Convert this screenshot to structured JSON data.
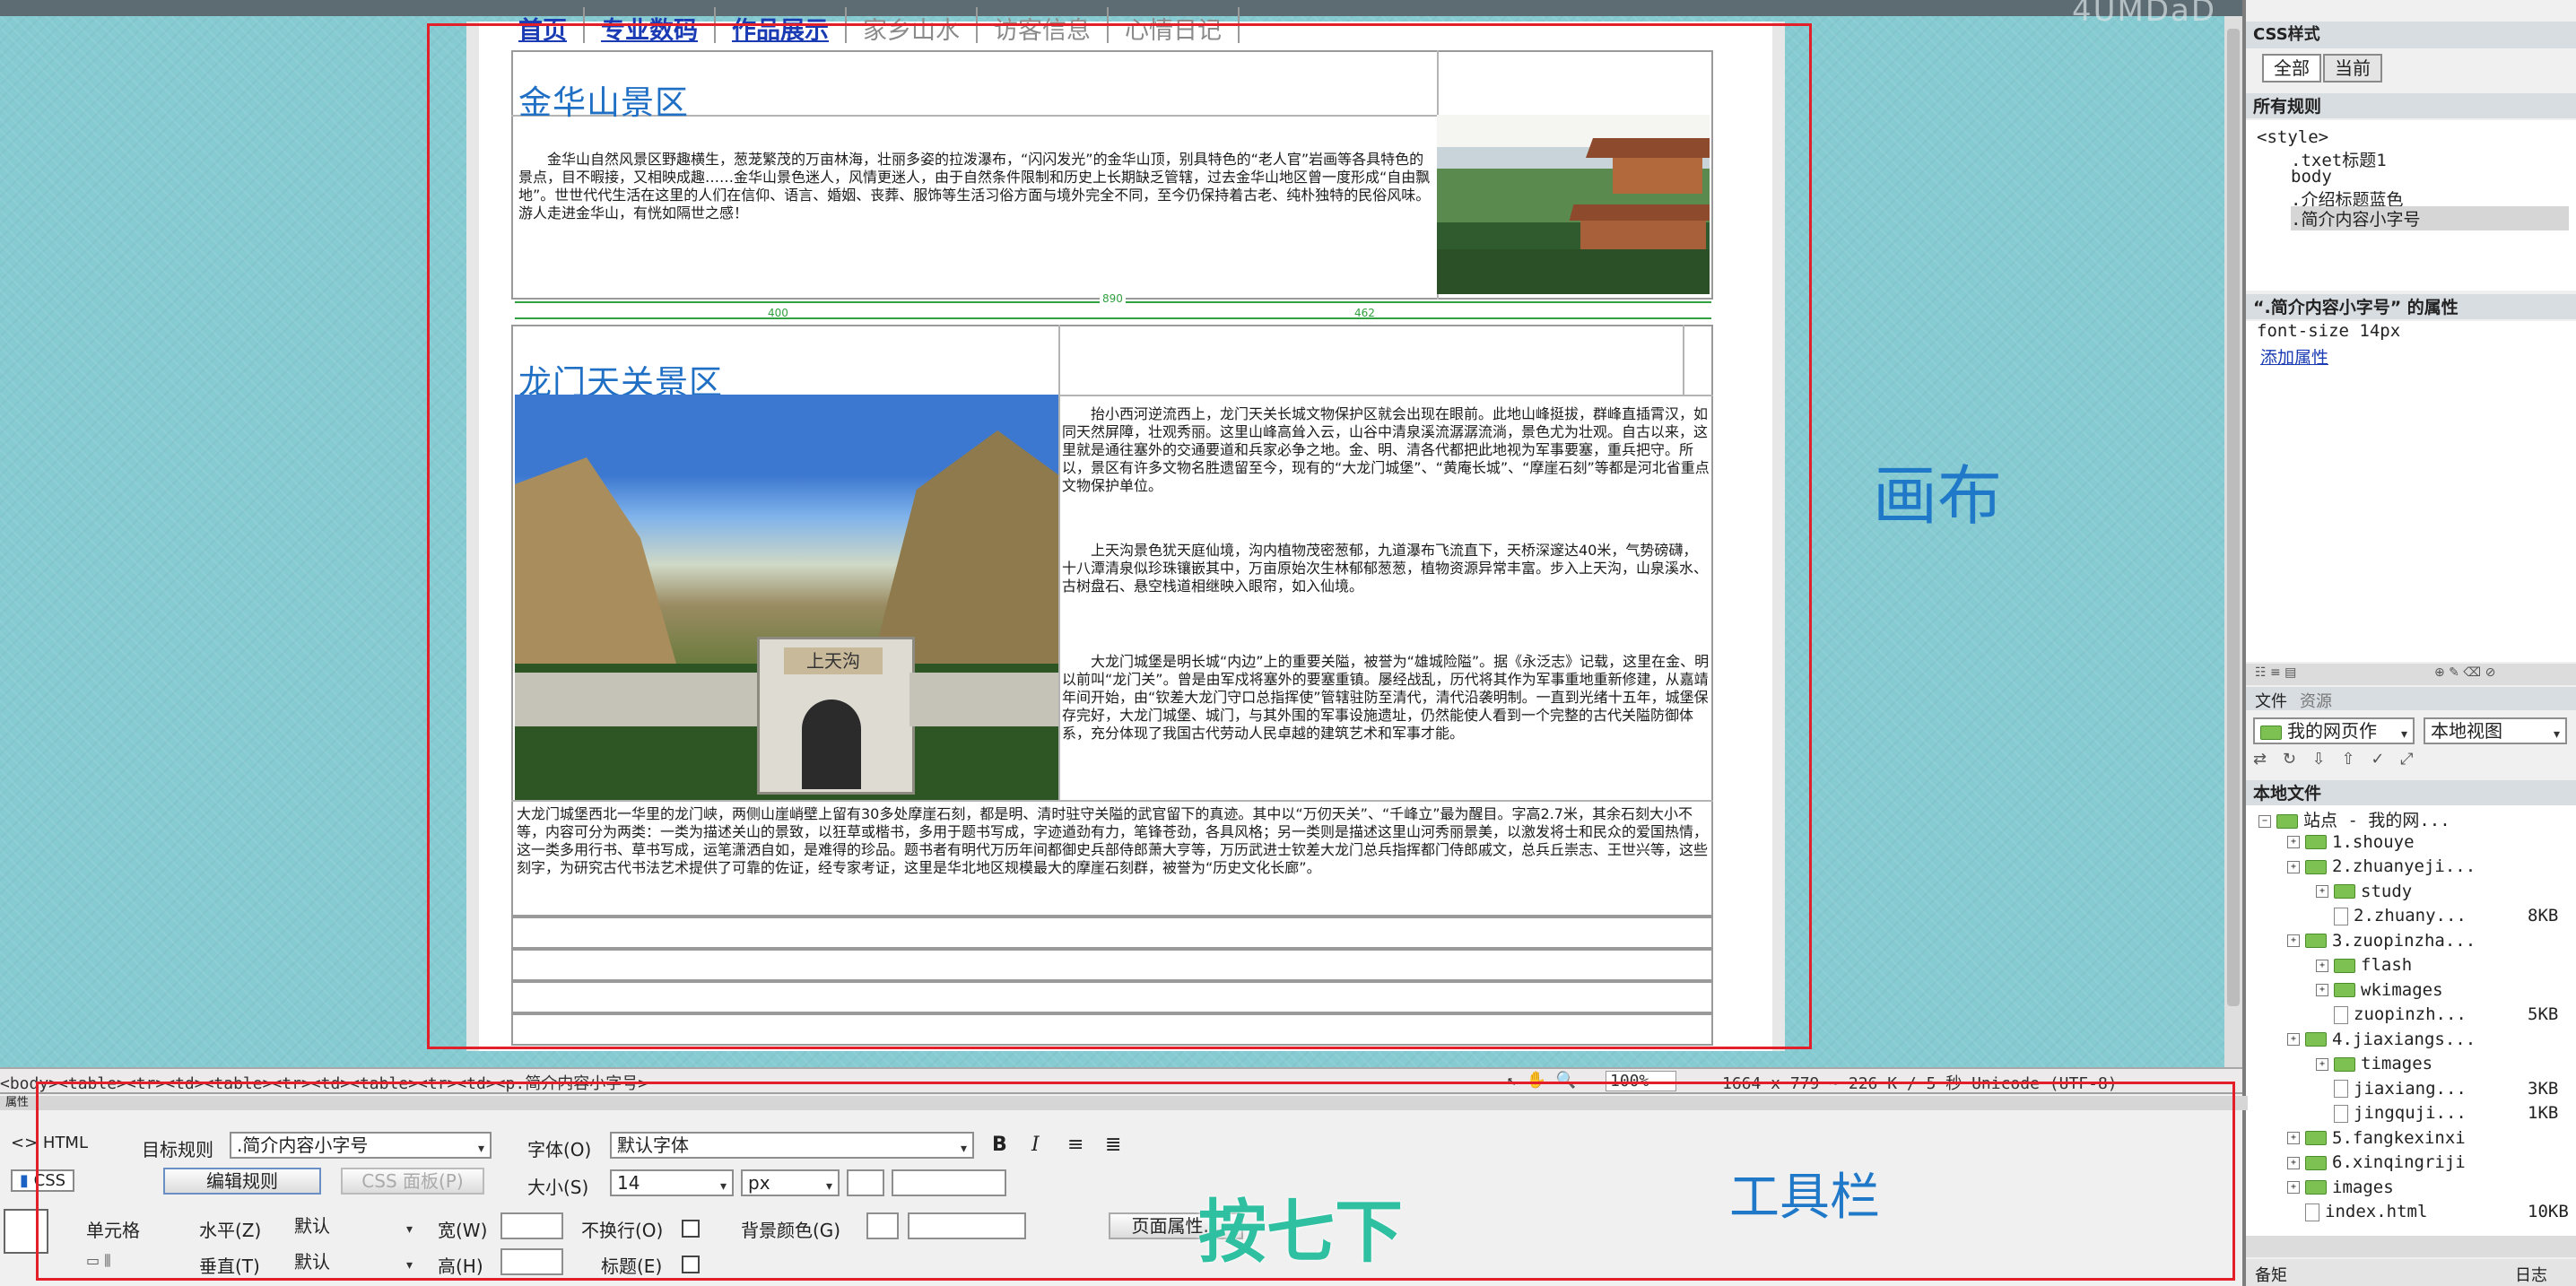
{
  "nav": {
    "items": [
      "首页",
      "专业数码",
      "作品展示",
      "家乡山水",
      "访客信息",
      "心情日记"
    ]
  },
  "section1": {
    "title": "金华山景区",
    "text": "金华山自然风景区野趣横生，葱茏繁茂的万亩林海，壮丽多姿的拉泼瀑布，“闪闪发光”的金华山顶，别具特色的“老人官”岩画等各具特色的景点，目不暇接，又相映成趣……金华山景色迷人，风情更迷人，由于自然条件限制和历史上长期缺乏管辖，过去金华山地区曾一度形成“自由飘地”。世世代代生活在这里的人们在信仰、语言、婚姻、丧葬、服饰等生活习俗方面与境外完全不同，至今仍保持着古老、纯朴独特的民俗风味。游人走进金华山，有恍如隔世之感！"
  },
  "ruler": {
    "label_total": "890",
    "label_left": "400",
    "label_right": "462"
  },
  "section2": {
    "title": "龙门天关景区",
    "gate_sign": "上天沟",
    "text_p1": "抬小西河逆流西上，龙门天关长城文物保护区就会出现在眼前。此地山峰挺拔，群峰直插霄汉，如同天然屏障，壮观秀丽。这里山峰高耸入云，山谷中清泉溪流潺潺流淌，景色尤为壮观。自古以来，这里就是通往塞外的交通要道和兵家必争之地。金、明、清各代都把此地视为军事要塞，重兵把守。所以，景区有许多文物名胜遗留至今，现有的“大龙门城堡”、“黄庵长城”、“摩崖石刻”等都是河北省重点文物保护单位。",
    "text_p2": "上天沟景色犹天庭仙境，沟内植物茂密葱郁，九道瀑布飞流直下，天桥深邃达40米，气势磅礴，十八潭清泉似珍珠镶嵌其中，万亩原始次生林郁郁葱葱，植物资源异常丰富。步入上天沟，山泉溪水、古树盘石、悬空栈道相继映入眼帘，如入仙境。",
    "text_p3": "大龙门城堡是明长城“内边”上的重要关隘，被誉为“雄城险隘”。据《永泛志》记载，这里在金、明以前叫“龙门关”。曾是由军戍将塞外的要塞重镇。屡经战乱，历代将其作为军事重地重新修建，从嘉靖年间开始，由“钦差大龙门守口总指挥使”管辖驻防至清代，清代沿袭明制。一直到光绪十五年，城堡保存完好，大龙门城堡、城门，与其外围的军事设施遗址，仍然能使人看到一个完整的古代关隘防御体系，充分体现了我国古代劳动人民卓越的建筑艺术和军事才能。",
    "text_wide": "大龙门城堡西北一华里的龙门峡，两侧山崖峭壁上留有30多处摩崖石刻，都是明、清时驻守关隘的武官留下的真迹。其中以“万仞天关”、“千峰立”最为醒目。字高2.7米，其余石刻大小不等，内容可分为两类：一类为描述关山的景致，以狂草或楷书，多用于题书写成，字迹遒劲有力，笔锋苍劲，各具风格；另一类则是描述这里山河秀丽景美，以激发将士和民众的爱国热情，这一类多用行书、草书写成，运笔潇洒自如，是难得的珍品。题书者有明代万历年间都御史兵部侍郎萧大亨等，万历武进士钦差大龙门总兵指挥都门侍郎戚文，总兵丘崇志、王世兴等，这些刻字，为研究古代书法艺术提供了可靠的佐证，经专家考证，这里是华北地区规模最大的摩崖石刻群，被誉为“历史文化长廊”。"
  },
  "annotations": {
    "canvas": "画布",
    "toolbar": "工具栏",
    "press": "按七下"
  },
  "top_brand": "4UMDaD",
  "status_bar": {
    "tag_path": "<body><table><tr><td><table><tr><td><table><tr><td><p.简介内容小字号>",
    "zoom": "100%",
    "size_info": "1664 x 779 ~ 226 K / 5 秒  Unicode (UTF-8)"
  },
  "right_panel": {
    "header_title": "CSS样式",
    "tabs": [
      "全部",
      "当前"
    ],
    "all_rules_label": "所有规则",
    "rules": [
      "<style>",
      ".txet标题1",
      "body",
      ".介绍标题蓝色",
      ".简介内容小字号"
    ],
    "props_title": "“.简介内容小字号” 的属性",
    "prop_row": "font-size   14px",
    "add_property": "添加属性",
    "files_tabs": [
      "文件",
      "资源"
    ],
    "site_select": "我的网页作",
    "view_select": "本地视图",
    "local_files_label": "本地文件",
    "tree": [
      {
        "label": "站点 - 我的网...",
        "type": "folder",
        "depth": 0,
        "size": ""
      },
      {
        "label": "1.shouye",
        "type": "folder",
        "depth": 1,
        "size": ""
      },
      {
        "label": "2.zhuanyeji...",
        "type": "folder",
        "depth": 1,
        "size": ""
      },
      {
        "label": "study",
        "type": "folder",
        "depth": 2,
        "size": ""
      },
      {
        "label": "2.zhuany...",
        "type": "file",
        "depth": 2,
        "size": "8KB"
      },
      {
        "label": "3.zuopinzha...",
        "type": "folder",
        "depth": 1,
        "size": ""
      },
      {
        "label": "flash",
        "type": "folder",
        "depth": 2,
        "size": ""
      },
      {
        "label": "wkimages",
        "type": "folder",
        "depth": 2,
        "size": ""
      },
      {
        "label": "zuopinzh...",
        "type": "file",
        "depth": 2,
        "size": "5KB"
      },
      {
        "label": "4.jiaxiangs...",
        "type": "folder",
        "depth": 1,
        "size": ""
      },
      {
        "label": "timages",
        "type": "folder",
        "depth": 2,
        "size": ""
      },
      {
        "label": "jiaxiang...",
        "type": "file",
        "depth": 2,
        "size": "3KB"
      },
      {
        "label": "jingquji...",
        "type": "file",
        "depth": 2,
        "size": "1KB"
      },
      {
        "label": "5.fangkexinxi",
        "type": "folder",
        "depth": 1,
        "size": ""
      },
      {
        "label": "6.xinqingriji",
        "type": "folder",
        "depth": 1,
        "size": ""
      },
      {
        "label": "images",
        "type": "folder",
        "depth": 1,
        "size": ""
      },
      {
        "label": "index.html",
        "type": "file",
        "depth": 1,
        "size": "10KB"
      }
    ],
    "bottom_left": "备矩",
    "bottom_right": "日志"
  },
  "properties": {
    "title": "属性",
    "html_tab": "HTML",
    "css_tab": "CSS",
    "target_rule_label": "目标规则",
    "target_rule_value": ".简介内容小字号",
    "edit_rule_button": "编辑规则",
    "css_panel_button": "CSS 面板(P)",
    "font_label": "字体(O)",
    "font_value": "默认字体",
    "size_label": "大小(S)",
    "size_value": "14",
    "unit_value": "px",
    "cell_label": "单元格",
    "horz_label": "水平(Z)",
    "horz_value": "默认",
    "width_label": "宽(W)",
    "nowrap_label": "不换行(O)",
    "bg_label": "背景颜色(G)",
    "page_props_button": "页面属性...",
    "vert_label": "垂直(T)",
    "vert_value": "默认",
    "height_label": "高(H)",
    "header_label": "标题(E)"
  }
}
